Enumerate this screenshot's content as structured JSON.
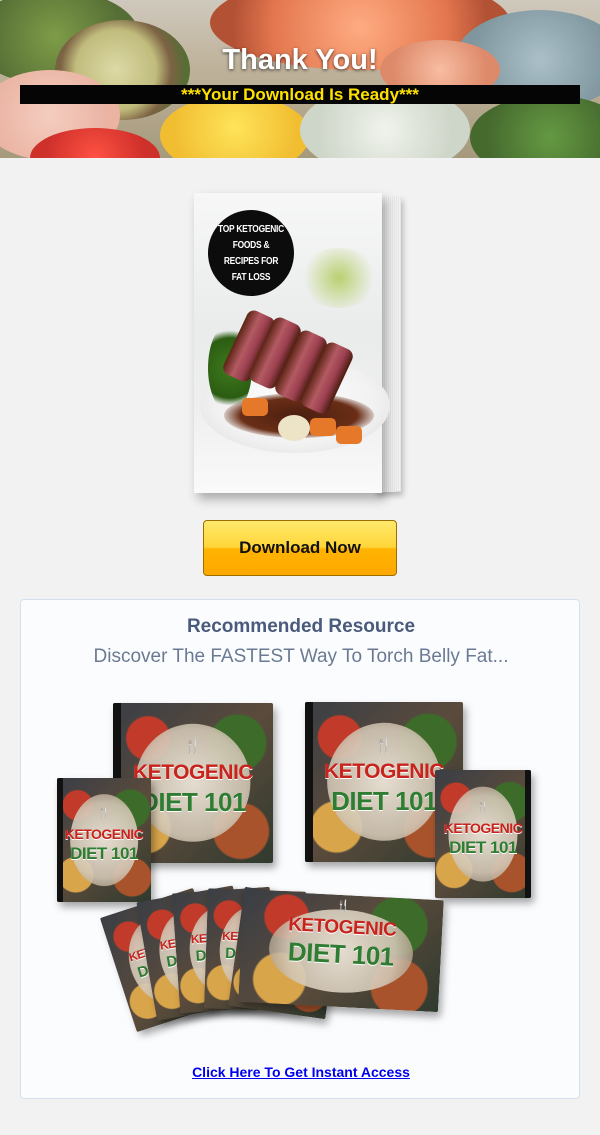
{
  "header": {
    "title": "Thank You!",
    "subtitle": "***Your Download Is Ready***"
  },
  "ebook": {
    "badge_text": "Top Ketogenic Foods & Recipes For Fat Loss"
  },
  "download_button": {
    "label": "Download Now"
  },
  "recommended": {
    "title": "Recommended Resource",
    "subtitle": "Discover The FASTEST Way To Torch Belly Fat...",
    "product": {
      "title_line1": "KETOGENIC",
      "title_line2": "DIET 101",
      "utensils_glyph": "🍴"
    },
    "cta_link": "Click Here To Get Instant Access"
  },
  "colors": {
    "page_background": "#f2f2f2",
    "ready_text": "#ffe100",
    "button_top": "#ffe96b",
    "button_bottom": "#ffa800",
    "panel_title": "#4a5a7c",
    "link": "#0000ee",
    "product_red": "#c8231d",
    "product_green": "#2e7d32"
  }
}
